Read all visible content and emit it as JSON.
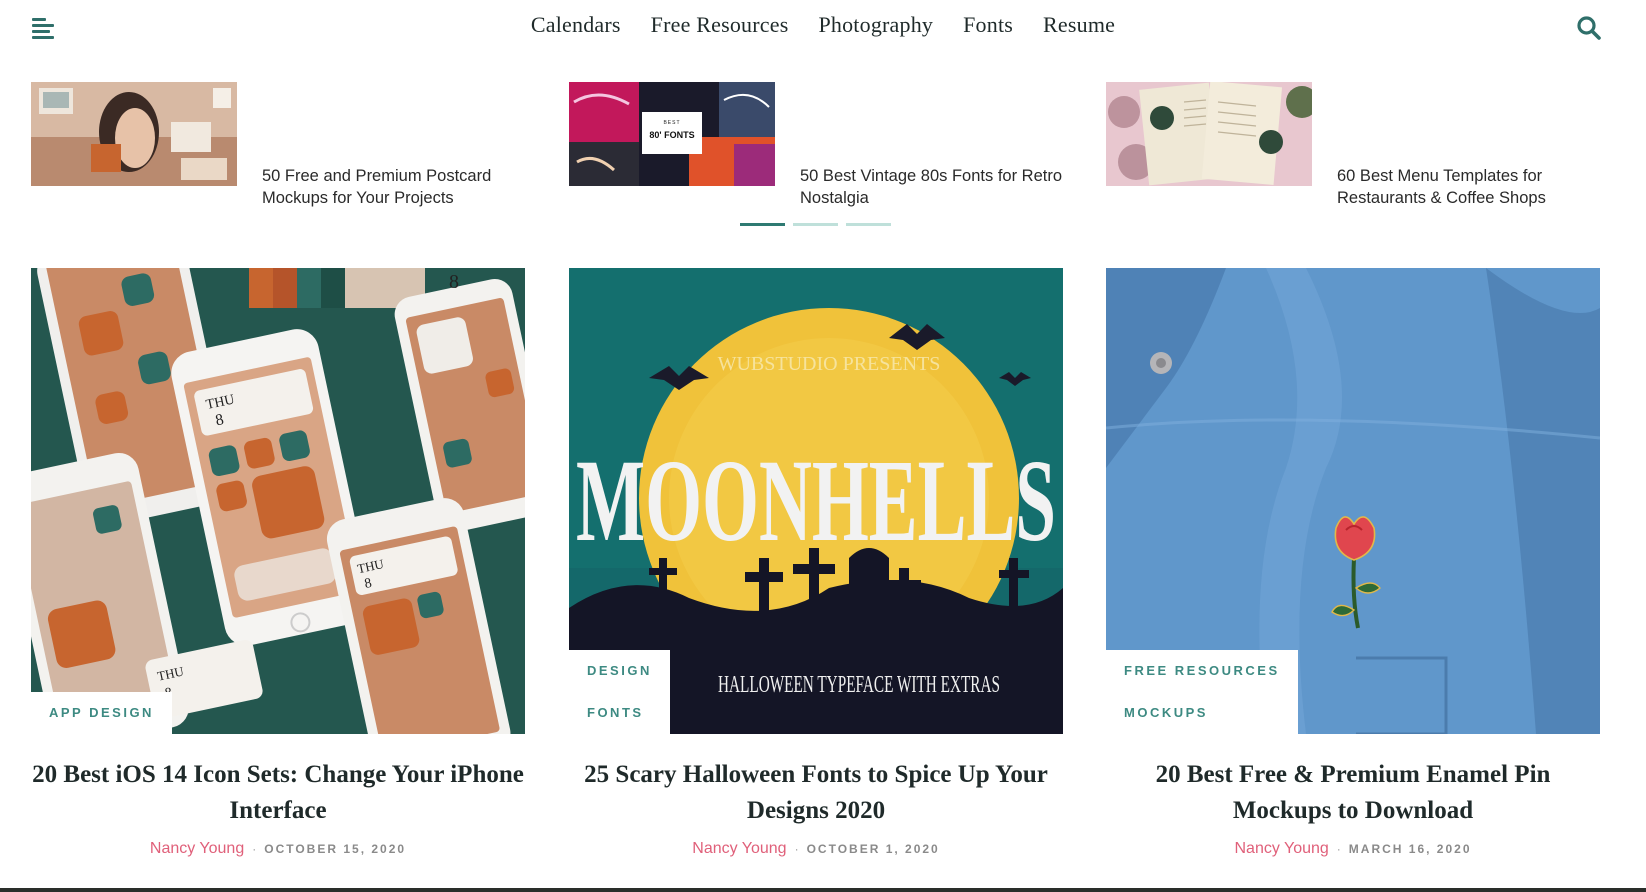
{
  "nav": {
    "items": [
      "Calendars",
      "Free Resources",
      "Photography",
      "Fonts",
      "Resume"
    ]
  },
  "icons": {
    "menu": "hamburger-menu-icon",
    "search": "search-icon"
  },
  "slider": {
    "slides": [
      {
        "caption": "50 Free and Premium Postcard Mockups for Your Projects"
      },
      {
        "caption": "50 Best Vintage 80s Fonts for Retro Nostalgia",
        "thumb_text": [
          "BEST",
          "80' FONTS"
        ]
      },
      {
        "caption": "60 Best Menu Templates for Restaurants & Coffee Shops"
      }
    ],
    "active_index": 0
  },
  "cards": [
    {
      "tags": [
        "APP DESIGN"
      ],
      "title": "20 Best iOS 14 Icon Sets: Change Your iPhone Interface",
      "author": "Nancy Young",
      "date": "OCTOBER 15, 2020",
      "image_text": [
        "THU",
        "8",
        "THU",
        "8",
        "THU",
        "8"
      ]
    },
    {
      "tags": [
        "DESIGN",
        "FONTS"
      ],
      "title": "25 Scary Halloween Fonts to Spice Up Your Designs 2020",
      "author": "Nancy Young",
      "date": "OCTOBER 1, 2020",
      "image_text": [
        "WUBSTUDIO PRESENTS",
        "MOONHELLS",
        "HALLOWEEN TYPEFACE WITH EXTRAS"
      ]
    },
    {
      "tags": [
        "FREE RESOURCES",
        "MOCKUPS"
      ],
      "title": "20 Best Free & Premium Enamel Pin Mockups to Download",
      "author": "Nancy Young",
      "date": "MARCH 16, 2020"
    }
  ],
  "colors": {
    "accent": "#2f7a72",
    "tag": "#3d8a82",
    "author": "#e0607a",
    "date": "#8a8a8a"
  }
}
